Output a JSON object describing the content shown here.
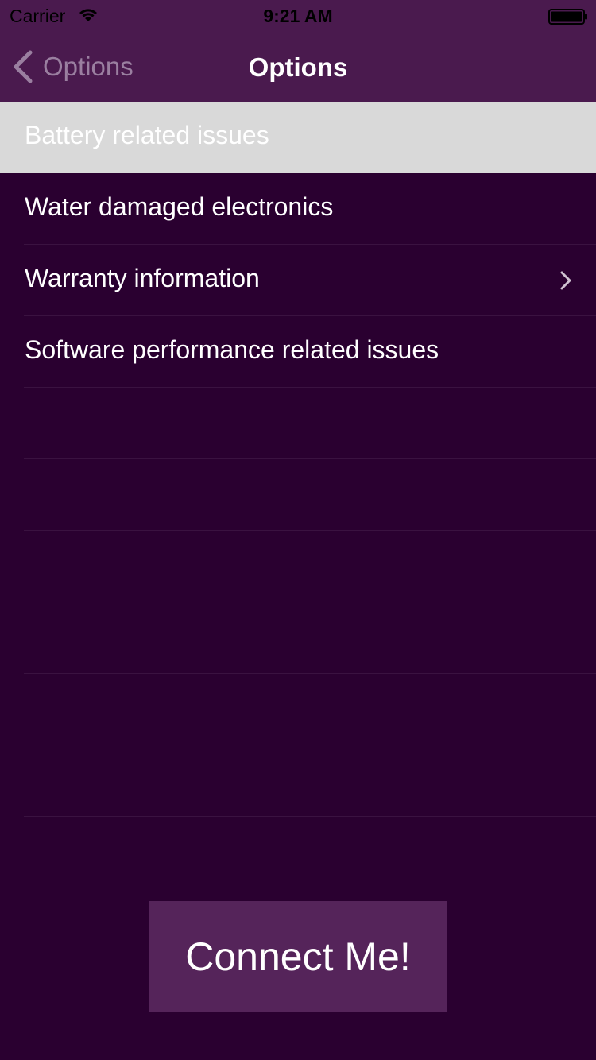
{
  "status_bar": {
    "carrier": "Carrier",
    "time": "9:21 AM",
    "wifi_icon": "wifi-icon",
    "battery_icon": "battery-icon"
  },
  "nav": {
    "back_label": "Options",
    "title": "Options"
  },
  "list": {
    "items": [
      {
        "label": "Battery related issues",
        "selected": true
      },
      {
        "label": "Water damaged electronics",
        "selected": false
      },
      {
        "label": "Warranty information",
        "selected": false,
        "has_chevron": true
      },
      {
        "label": "Software performance related issues",
        "selected": false
      }
    ]
  },
  "connect_button": {
    "label": "Connect Me!"
  },
  "colors": {
    "top_bar": "#4a1a4e",
    "background": "#2a0030",
    "selected_row": "#d9d9d9",
    "button": "#55245a"
  }
}
